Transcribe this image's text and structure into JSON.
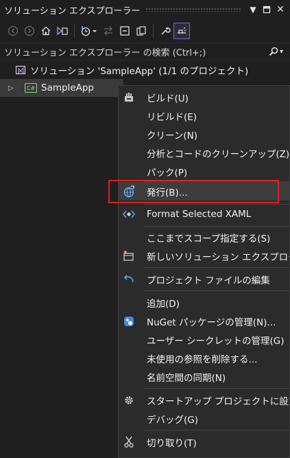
{
  "titlebar": {
    "title": "ソリューション エクスプローラー",
    "dropdown_glyph": "▼",
    "pin_glyph": "▣",
    "close_glyph": "✕"
  },
  "search": {
    "placeholder": "ソリューション エクスプローラー の検索 (Ctrl+;)",
    "dropdown_glyph": "▾"
  },
  "tree": {
    "solution_label": "ソリューション 'SampleApp' (1/1 のプロジェクト)",
    "project_label": "SampleApp",
    "project_badge": "C#"
  },
  "context_menu": {
    "items": [
      {
        "label": "ビルド(U)",
        "icon": "build-icon"
      },
      {
        "label": "リビルド(E)"
      },
      {
        "label": "クリーン(N)"
      },
      {
        "label": "分析とコードのクリーンアップ(Z)"
      },
      {
        "label": "パック(P)"
      },
      {
        "label": "発行(B)...",
        "icon": "publish-globe-icon",
        "highlighted": true
      },
      {
        "label": "Format Selected XAML",
        "icon": "xaml-format-icon"
      },
      {
        "label": "ここまでスコープ指定する(S)"
      },
      {
        "label": "新しいソリューション エクスプローラーの",
        "icon": "new-explorer-view-icon"
      },
      {
        "label": "プロジェクト ファイルの編集",
        "icon": "edit-arrow-icon"
      },
      {
        "label": "追加(D)"
      },
      {
        "label": "NuGet パッケージの管理(N)...",
        "icon": "nuget-icon"
      },
      {
        "label": "ユーザー シークレットの管理(G)"
      },
      {
        "label": "未使用の参照を削除する..."
      },
      {
        "label": "名前空間の同期(N)"
      },
      {
        "label": "スタートアップ プロジェクトに設定(A)",
        "icon": "gear-icon"
      },
      {
        "label": "デバッグ(G)"
      },
      {
        "label": "切り取り(T)",
        "icon": "scissors-icon"
      }
    ]
  },
  "colors": {
    "accent": "#7b66d6",
    "highlight_box": "#e0201c",
    "menu_bg": "#2b2b2b",
    "panel_bg": "#1f1f1f"
  }
}
